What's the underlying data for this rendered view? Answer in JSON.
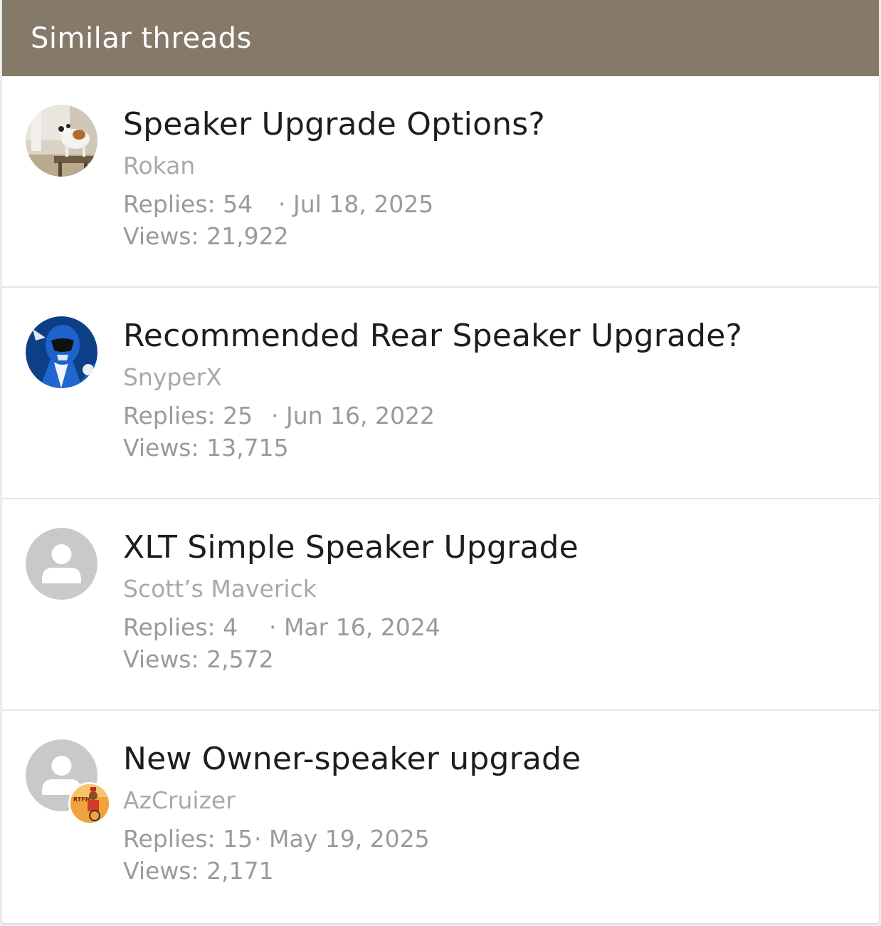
{
  "header": {
    "title": "Similar threads"
  },
  "threads": [
    {
      "title": "Speaker Upgrade Options?",
      "author": "Rokan",
      "replies": "Replies: 54",
      "date": "· Jul 18, 2025",
      "views": "Views: 21,922",
      "avatar": "dog-photo-avatar"
    },
    {
      "title": "Recommended Rear Speaker Upgrade?",
      "author": "SnyperX",
      "replies": "Replies: 25",
      "date": "· Jun 16, 2022",
      "views": "Views: 13,715",
      "avatar": "blue-ranger-avatar"
    },
    {
      "title": "XLT Simple Speaker Upgrade",
      "author": "Scott’s Maverick",
      "replies": "Replies: 4",
      "date": "· Mar 16, 2024",
      "views": "Views: 2,572",
      "avatar": "default-user-avatar"
    },
    {
      "title": "New Owner-speaker upgrade",
      "author": "AzCruizer",
      "replies": "Replies: 15",
      "date": "· May 19, 2025",
      "views": "Views: 2,171",
      "avatar": "default-user-avatar",
      "badge_text": "RTFM!"
    }
  ],
  "colors": {
    "header_bg": "#857969",
    "header_text": "#ffffff",
    "title_text": "#1d1d1d",
    "meta_text": "#9a9a9a",
    "author_text": "#a9a9a9"
  }
}
